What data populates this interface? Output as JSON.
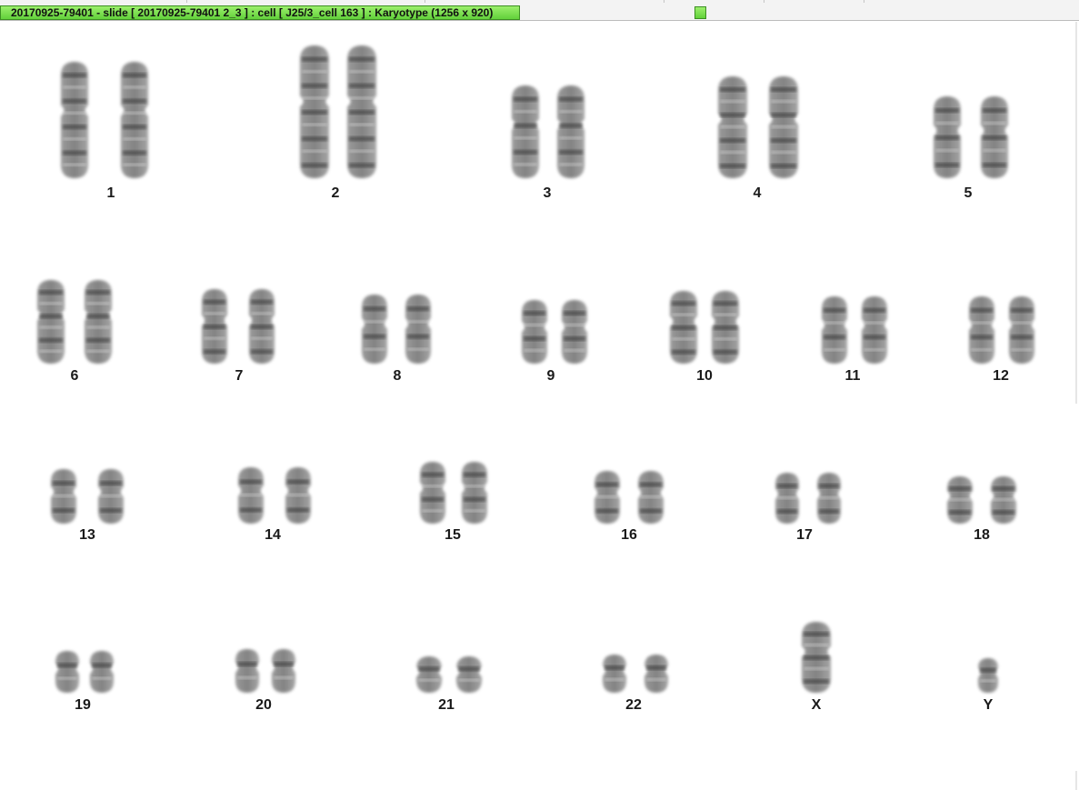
{
  "window": {
    "title": "20170925-79401 - slide [ 20170925-79401 2_3 ] : cell [ J25/3_cell 163 ] : Karyotype  (1256 x 920)"
  },
  "colors": {
    "title_accent": "#62d13a",
    "chromosome": "#4a4a4a",
    "background": "#ffffff"
  },
  "karyotype": {
    "chromosomes": [
      {
        "label": "1"
      },
      {
        "label": "2"
      },
      {
        "label": "3"
      },
      {
        "label": "4"
      },
      {
        "label": "5"
      },
      {
        "label": "6"
      },
      {
        "label": "7"
      },
      {
        "label": "8"
      },
      {
        "label": "9"
      },
      {
        "label": "10"
      },
      {
        "label": "11"
      },
      {
        "label": "12"
      },
      {
        "label": "13"
      },
      {
        "label": "14"
      },
      {
        "label": "15"
      },
      {
        "label": "16"
      },
      {
        "label": "17"
      },
      {
        "label": "18"
      },
      {
        "label": "19"
      },
      {
        "label": "20"
      },
      {
        "label": "21"
      },
      {
        "label": "22"
      },
      {
        "label": "X"
      },
      {
        "label": "Y"
      }
    ]
  }
}
